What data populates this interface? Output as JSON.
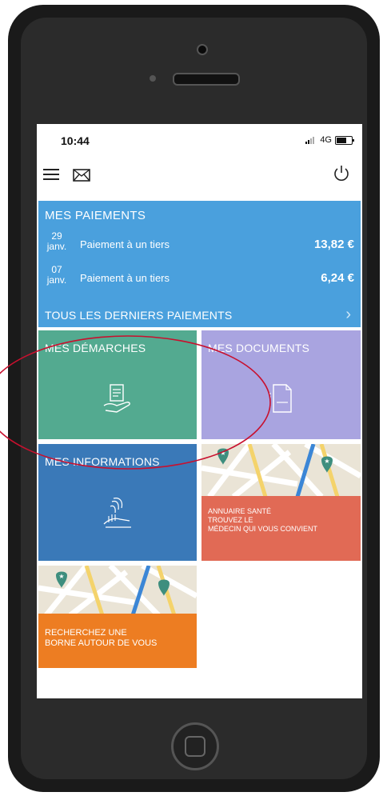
{
  "status_bar": {
    "time": "10:44",
    "network": "4G"
  },
  "payments": {
    "title": "MES PAIEMENTS",
    "rows": [
      {
        "day": "29",
        "month": "janv.",
        "label": "Paiement à un tiers",
        "amount": "13,82 €"
      },
      {
        "day": "07",
        "month": "janv.",
        "label": "Paiement à un tiers",
        "amount": "6,24 €"
      }
    ],
    "all_link": "TOUS LES DERNIERS PAIEMENTS"
  },
  "tiles": {
    "demarches": "MES DÉMARCHES",
    "documents": "MES DOCUMENTS",
    "informations": "MES INFORMATIONS",
    "annuaire_line1": "ANNUAIRE SANTÉ",
    "annuaire_line2": "TROUVEZ LE",
    "annuaire_line3": "MÉDECIN QUI VOUS CONVIENT",
    "borne_line1": "RECHERCHEZ UNE",
    "borne_line2": "BORNE AUTOUR DE VOUS"
  },
  "colors": {
    "payments": "#4aa0dd",
    "demarches": "#53aa90",
    "documents": "#a9a4e0",
    "informations": "#3a79b8",
    "annuaire": "#e16a55",
    "borne": "#ed7d22",
    "annotation": "#c8102e"
  },
  "icons": [
    "menu-icon",
    "mail-icon",
    "power-icon",
    "chevron-right-icon",
    "hand-document-icon",
    "document-icon",
    "fingerprint-hand-icon",
    "map-pin-icon"
  ]
}
